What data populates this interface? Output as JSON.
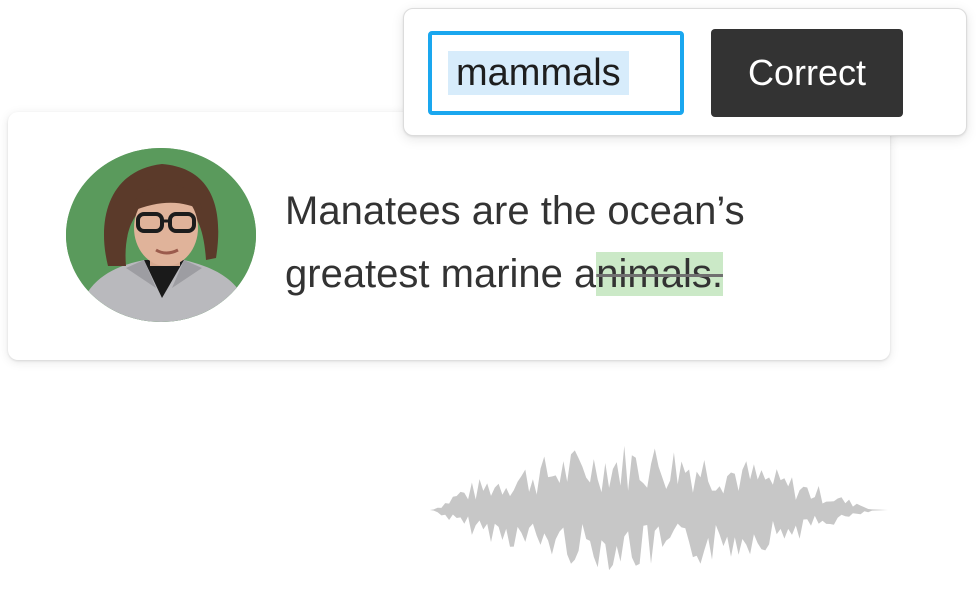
{
  "popup": {
    "input_value": "mammals",
    "button_label": "Correct"
  },
  "transcript": {
    "line1": "Manatees are the ocean’s",
    "line2_prefix": "greatest marine a",
    "line2_highlight": "nimals."
  },
  "colors": {
    "input_border": "#1aa7ef",
    "input_selection": "#d7ecfb",
    "button_bg": "#333333",
    "highlight": "#cbe9c7",
    "waveform": "#c7c7c7",
    "avatar_background": "#5a9a5c"
  },
  "icons": {
    "avatar": "speaker-avatar",
    "waveform": "audio-waveform-icon"
  }
}
